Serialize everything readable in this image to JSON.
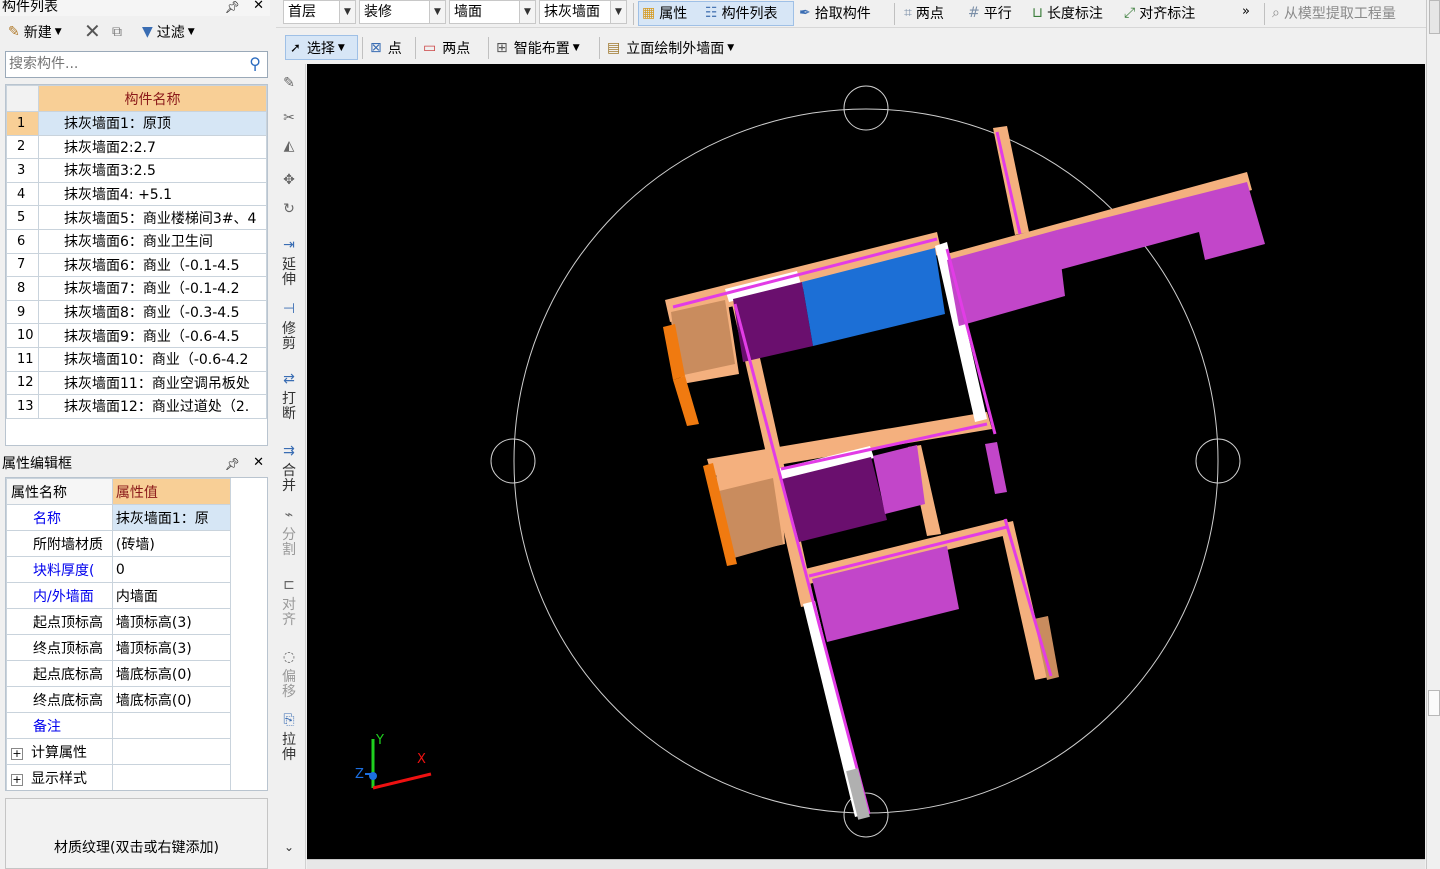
{
  "component_list": {
    "title": "构件列表",
    "toolbar": {
      "new_label": "新建",
      "filter_label": "过滤"
    },
    "search": {
      "placeholder": "搜索构件..."
    },
    "column_header": "构件名称",
    "rows": [
      {
        "n": "1",
        "name": "抹灰墙面1：原顶"
      },
      {
        "n": "2",
        "name": "抹灰墙面2:2.7"
      },
      {
        "n": "3",
        "name": "抹灰墙面3:2.5"
      },
      {
        "n": "4",
        "name": "抹灰墙面4: +5.1"
      },
      {
        "n": "5",
        "name": "抹灰墙面5：商业楼梯间3#、4"
      },
      {
        "n": "6",
        "name": "抹灰墙面6：商业卫生间"
      },
      {
        "n": "7",
        "name": "抹灰墙面6：商业（-0.1-4.5"
      },
      {
        "n": "8",
        "name": "抹灰墙面7：商业（-0.1-4.2"
      },
      {
        "n": "9",
        "name": "抹灰墙面8：商业（-0.3-4.5"
      },
      {
        "n": "10",
        "name": "抹灰墙面9：商业（-0.6-4.5"
      },
      {
        "n": "11",
        "name": "抹灰墙面10：商业（-0.6-4.2"
      },
      {
        "n": "12",
        "name": "抹灰墙面11：商业空调吊板处"
      },
      {
        "n": "13",
        "name": "抹灰墙面12：商业过道处（2."
      }
    ]
  },
  "property_editor": {
    "title": "属性编辑框",
    "header_name": "属性名称",
    "header_value": "属性值",
    "rows": [
      {
        "k": "名称",
        "v": "抹灰墙面1：原",
        "blue": true
      },
      {
        "k": "所附墙材质",
        "v": "(砖墙)",
        "blue": false
      },
      {
        "k": "块料厚度(",
        "v": "0",
        "blue": true
      },
      {
        "k": "内/外墙面",
        "v": "内墙面",
        "blue": true
      },
      {
        "k": "起点顶标高",
        "v": "墙顶标高(3)",
        "blue": false
      },
      {
        "k": "终点顶标高",
        "v": "墙顶标高(3)",
        "blue": false
      },
      {
        "k": "起点底标高",
        "v": "墙底标高(0)",
        "blue": false
      },
      {
        "k": "终点底标高",
        "v": "墙底标高(0)",
        "blue": false
      },
      {
        "k": "备注",
        "v": "",
        "blue": true
      }
    ],
    "groups": [
      "计算属性",
      "显示样式"
    ]
  },
  "material_hint": "材质纹理(双击或右键添加)",
  "top_toolbar": {
    "floor": "首层",
    "category": "装修",
    "type": "墙面",
    "subtype": "抹灰墙面",
    "buttons": [
      "属性",
      "构件列表",
      "拾取构件",
      "两点",
      "平行",
      "长度标注",
      "对齐标注",
      "从模型提取工程量"
    ]
  },
  "draw_toolbar": {
    "buttons": [
      "选择",
      "点",
      "两点",
      "智能布置",
      "立面绘制外墙面"
    ]
  },
  "side_tools": [
    "延伸",
    "修剪",
    "打断",
    "合并",
    "分割",
    "对齐",
    "偏移",
    "拉伸"
  ],
  "axis": {
    "x": "X",
    "y": "Y",
    "z": "Z"
  },
  "colors": {
    "canvas": "#000000",
    "wall_tan": "#f4b07e",
    "wall_magenta": "#c246c9",
    "wall_purple": "#6a0f6e",
    "wall_blue": "#1c6fd6",
    "selected_row": "#d6e6f5",
    "header_bg": "#f8cf96"
  }
}
